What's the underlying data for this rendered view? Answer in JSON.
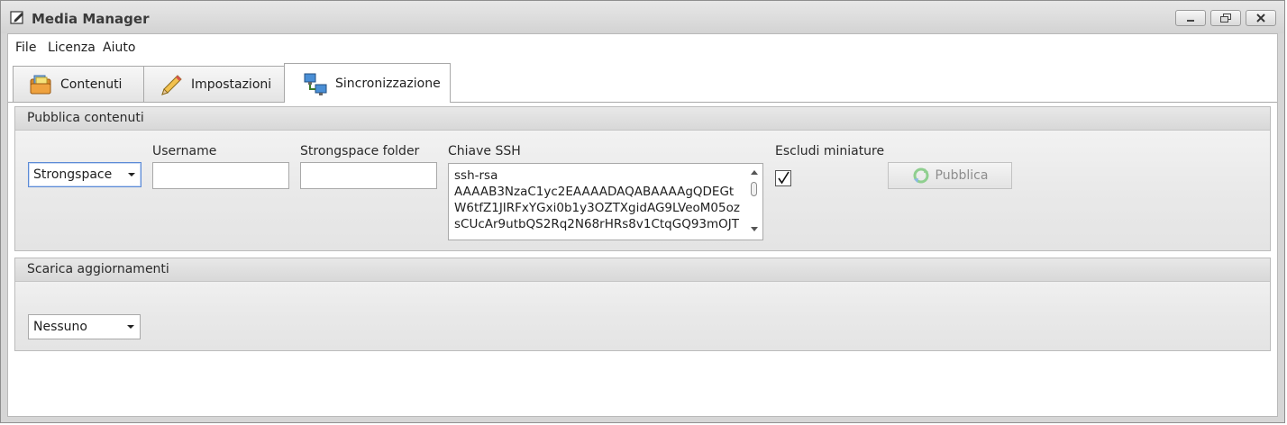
{
  "window": {
    "title": "Media Manager"
  },
  "menu": [
    "File",
    "Licenza",
    "Aiuto"
  ],
  "tabs": [
    {
      "label": "Contenuti",
      "icon": "folder-photos-icon",
      "active": false
    },
    {
      "label": "Impostazioni",
      "icon": "pencil-icon",
      "active": false
    },
    {
      "label": "Sincronizzazione",
      "icon": "network-computers-icon",
      "active": true
    }
  ],
  "publish": {
    "title": "Pubblica contenuti",
    "service": "Strongspace",
    "username_label": "Username",
    "username_value": "",
    "folder_label": "Strongspace folder",
    "folder_value": "",
    "ssh_label": "Chiave SSH",
    "ssh_lines": [
      "ssh-rsa",
      "AAAAB3NzaC1yc2EAAAADAQABAAAAgQDEGt",
      "W6tfZ1JIRFxYGxi0b1y3OZTXgidAG9LVeoM05oz",
      "sCUcAr9utbQS2Rq2N68rHRs8v1CtqGQ93mOJT"
    ],
    "exclude_label": "Escludi miniature",
    "exclude_checked": true,
    "button_label": "Pubblica"
  },
  "download": {
    "title": "Scarica aggiornamenti",
    "source": "Nessuno"
  }
}
